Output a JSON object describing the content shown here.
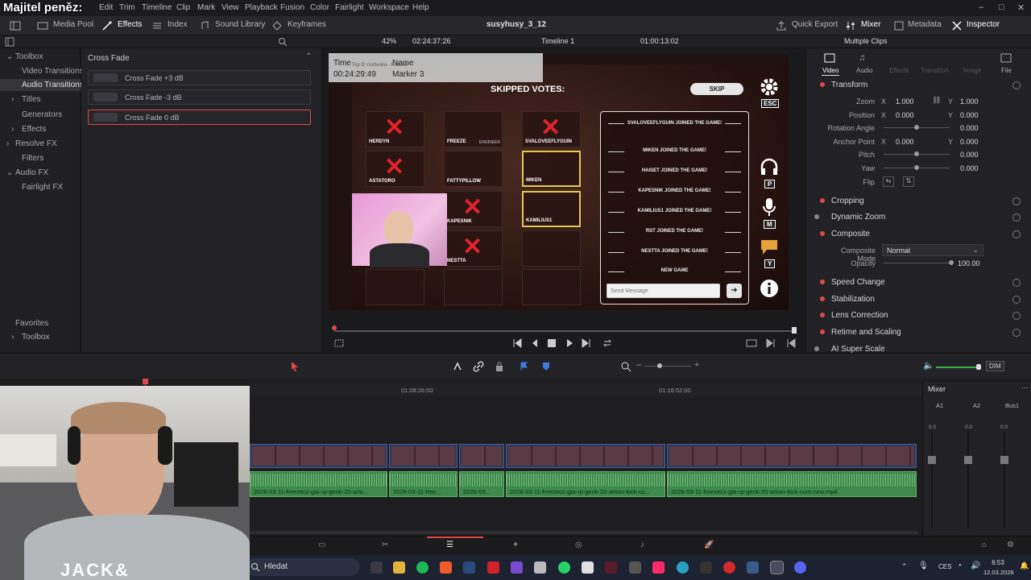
{
  "overlay_title": "Majitel peněz:",
  "menu": [
    "Edit",
    "Trim",
    "Timeline",
    "Clip",
    "Mark",
    "View",
    "Playback",
    "Fusion",
    "Color",
    "Fairlight",
    "Workspace",
    "Help"
  ],
  "toolbar": {
    "media_pool": "Media Pool",
    "effects": "Effects",
    "index": "Index",
    "sound_library": "Sound Library",
    "keyframes": "Keyframes",
    "project_title": "susyhusy_3_12",
    "quick_export": "Quick Export",
    "mixer": "Mixer",
    "metadata": "Metadata",
    "inspector": "Inspector"
  },
  "viewer_bar": {
    "zoom": "42%",
    "timecode": "02:24:37:26",
    "timeline_name": "Timeline 1",
    "record_tc": "01:00:13:02",
    "multiple_clips": "Multiple Clips"
  },
  "left_panel": {
    "toolbox": "Toolbox",
    "video_transitions": "Video Transitions",
    "audio_transitions": "Audio Transitions",
    "titles": "Titles",
    "generators": "Generators",
    "effects": "Effects",
    "resolve_fx": "Resolve FX",
    "filters": "Filters",
    "audio_fx": "Audio FX",
    "fairlight_fx": "Fairlight FX",
    "favorites": "Favorites",
    "fav_toolbox": "Toolbox"
  },
  "effects_panel": {
    "header": "Cross Fade",
    "items": [
      "Cross Fade +3 dB",
      "Cross Fade -3 dB",
      "Cross Fade 0 dB"
    ]
  },
  "marker_overlay": {
    "time_label": "Time",
    "name_label": "Name",
    "time_value": "00:24:29:49",
    "name_value": "Marker 3",
    "stream_tag": "Top D: rozbuska - Kč1050"
  },
  "game": {
    "title": "SKIPPED VOTES:",
    "skip": "SKIP",
    "esc": "ESC",
    "tiles": [
      "HERDYN",
      "FREEZE",
      "SVALOVEEFLYGUIN",
      "ASTATORO",
      "FATTYPILLOW",
      "MIKEN",
      "KAPESNIK",
      "KAMILIUS1",
      "NESTTA"
    ],
    "engineer": "ENGINEER",
    "chat": [
      "SVALOVEEFLYGUIN JOINED THE GAME!",
      "MIKEN JOINED THE GAME!",
      "HAISET JOINED THE GAME!",
      "KAPESNIK JOINED THE GAME!",
      "KAMILIUS1 JOINED THE GAME!",
      "RST JOINED THE GAME!",
      "NESTTA JOINED THE GAME!",
      "NEW GAME"
    ],
    "send_placeholder": "Send Message",
    "key_p": "P",
    "key_m": "M",
    "key_y": "Y"
  },
  "inspector": {
    "tabs": [
      "Video",
      "Audio",
      "Effects",
      "Transition",
      "Image",
      "File"
    ],
    "transform": "Transform",
    "zoom_label": "Zoom",
    "zoom_x": "1.000",
    "zoom_y": "1.000",
    "position_label": "Position",
    "pos_x": "0.000",
    "pos_y": "0.000",
    "rotation_label": "Rotation Angle",
    "rotation": "0.000",
    "anchor_label": "Anchor Point",
    "anchor_x": "0.000",
    "anchor_y": "0.000",
    "pitch_label": "Pitch",
    "pitch": "0.000",
    "yaw_label": "Yaw",
    "yaw": "0.000",
    "flip_label": "Flip",
    "x": "X",
    "y": "Y",
    "cropping": "Cropping",
    "dynamic_zoom": "Dynamic Zoom",
    "composite": "Composite",
    "composite_mode_label": "Composite Mode",
    "composite_mode": "Normal",
    "opacity_label": "Opacity",
    "opacity": "100.00",
    "speed_change": "Speed Change",
    "stabilization": "Stabilization",
    "lens_correction": "Lens Correction",
    "retime": "Retime and Scaling",
    "ai_super_scale": "AI Super Scale"
  },
  "timeline": {
    "ruler": [
      "01:08:26:00",
      "01:16:52:00"
    ],
    "audio_clips": [
      "2026-03-11-freezecz-gta-rp-genk-20-arto...",
      "2026-03-11-free...",
      "2026-03...",
      "2026-03-11-freezecz-gta-rp-genk-20-artom-kick-co...",
      "2026-03-11-freezecz-gta-rp-genk-20-artom-kick-com-new.mp4"
    ],
    "dim": "DIM"
  },
  "mixer": {
    "title": "Mixer",
    "channels": [
      "A1",
      "A2",
      "Bus1"
    ],
    "db": "0.0"
  },
  "taskbar": {
    "search": "Hledat",
    "lang": "CES",
    "time": "6:53",
    "date": "12.03.2026"
  }
}
